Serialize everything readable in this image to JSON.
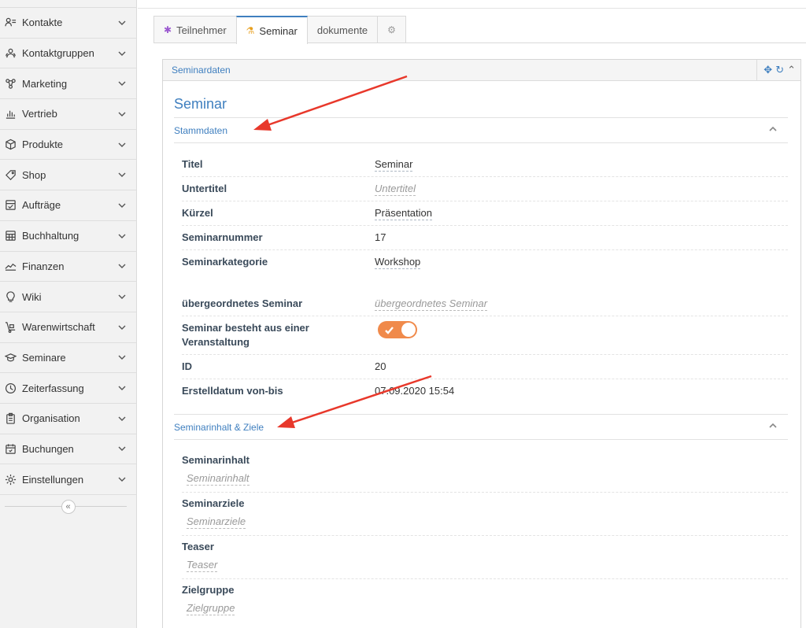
{
  "sidebar": {
    "items": [
      {
        "label": "Kontakte",
        "icon": "contacts-icon"
      },
      {
        "label": "Kontaktgruppen",
        "icon": "contact-groups-icon"
      },
      {
        "label": "Marketing",
        "icon": "marketing-icon"
      },
      {
        "label": "Vertrieb",
        "icon": "sales-chart-icon"
      },
      {
        "label": "Produkte",
        "icon": "box-icon"
      },
      {
        "label": "Shop",
        "icon": "tag-icon"
      },
      {
        "label": "Aufträge",
        "icon": "orders-icon"
      },
      {
        "label": "Buchhaltung",
        "icon": "accounting-icon"
      },
      {
        "label": "Finanzen",
        "icon": "finance-icon"
      },
      {
        "label": "Wiki",
        "icon": "bulb-icon"
      },
      {
        "label": "Warenwirtschaft",
        "icon": "dolly-icon"
      },
      {
        "label": "Seminare",
        "icon": "graduation-cap-icon"
      },
      {
        "label": "Zeiterfassung",
        "icon": "clock-icon"
      },
      {
        "label": "Organisation",
        "icon": "clipboard-icon"
      },
      {
        "label": "Buchungen",
        "icon": "calendar-icon"
      },
      {
        "label": "Einstellungen",
        "icon": "gear-icon"
      }
    ],
    "collapse_glyph": "«"
  },
  "tabs": [
    {
      "label": "Teilnehmer",
      "icon": "asterisk-icon",
      "icon_glyph": "✱",
      "icon_color": "#9b59d0"
    },
    {
      "label": "Seminar",
      "icon": "flask-icon",
      "icon_glyph": "⚗",
      "icon_color": "#e8a020",
      "active": true
    },
    {
      "label": "dokumente"
    },
    {
      "label": "",
      "icon": "gear-icon",
      "icon_glyph": "⚙",
      "icon_color": "#999"
    }
  ],
  "panel": {
    "title": "Seminardaten",
    "tools": {
      "move_glyph": "✥",
      "refresh_glyph": "↻",
      "collapse_glyph": "⌃"
    }
  },
  "main": {
    "heading": "Seminar",
    "sections": {
      "stammdaten": "Stammdaten",
      "inhalt": "Seminarinhalt & Ziele"
    },
    "fields": {
      "titel": {
        "label": "Titel",
        "value": "Seminar"
      },
      "untertitel": {
        "label": "Untertitel",
        "placeholder": "Untertitel"
      },
      "kuerzel": {
        "label": "Kürzel",
        "value": "Präsentation"
      },
      "seminarnummer": {
        "label": "Seminarnummer",
        "value": "17"
      },
      "seminarkategorie": {
        "label": "Seminarkategorie",
        "value": "Workshop"
      },
      "uebergeordnet": {
        "label": "übergeordnetes Seminar",
        "placeholder": "übergeordnetes Seminar"
      },
      "veranstaltung": {
        "label_line1": "Seminar besteht aus einer",
        "label_line2": "Veranstaltung",
        "toggle_on": true
      },
      "id": {
        "label": "ID",
        "value": "20"
      },
      "erstelldatum": {
        "label": "Erstelldatum von-bis",
        "value": "07.09.2020 15:54"
      }
    },
    "content_fields": {
      "inhalt": {
        "label": "Seminarinhalt",
        "placeholder": "Seminarinhalt"
      },
      "ziele": {
        "label": "Seminarziele",
        "placeholder": "Seminarziele"
      },
      "teaser": {
        "label": "Teaser",
        "placeholder": "Teaser"
      },
      "zielgruppe": {
        "label": "Zielgruppe",
        "placeholder": "Zielgruppe"
      }
    }
  },
  "colors": {
    "accent": "#3f7fbf",
    "toggle": "#f08a4b",
    "annotation_arrow": "#e8382b"
  }
}
